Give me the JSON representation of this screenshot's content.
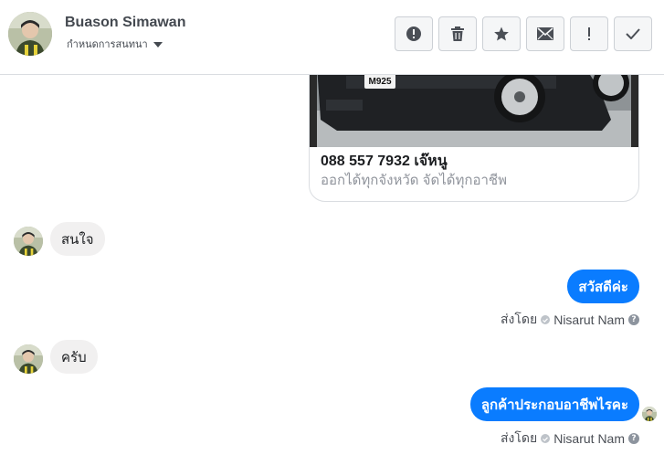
{
  "contact": {
    "name": "Buason Simawan",
    "subtitle": "กำหนดการสนทนา"
  },
  "toolbar": [
    {
      "name": "report-icon"
    },
    {
      "name": "trash-icon"
    },
    {
      "name": "star-icon"
    },
    {
      "name": "mail-icon"
    },
    {
      "name": "exclamation-icon"
    },
    {
      "name": "check-icon"
    }
  ],
  "card": {
    "plate": "M925",
    "title": "088 557 7932 เจ๊หนู",
    "subtitle": "ออกได้ทุกจังหวัด จัดได้ทุกอาชีพ"
  },
  "messages": {
    "in1": "สนใจ",
    "out1": "สวัสดีค่ะ",
    "in2": "ครับ",
    "out2": "ลูกค้าประกอบอาชีพไรคะ"
  },
  "sent_by": {
    "label": "ส่งโดย",
    "agent": "Nisarut Nam",
    "help": "?"
  },
  "colors": {
    "outgoing_bubble": "#0a7cff",
    "incoming_bubble": "#f1f0f0"
  }
}
